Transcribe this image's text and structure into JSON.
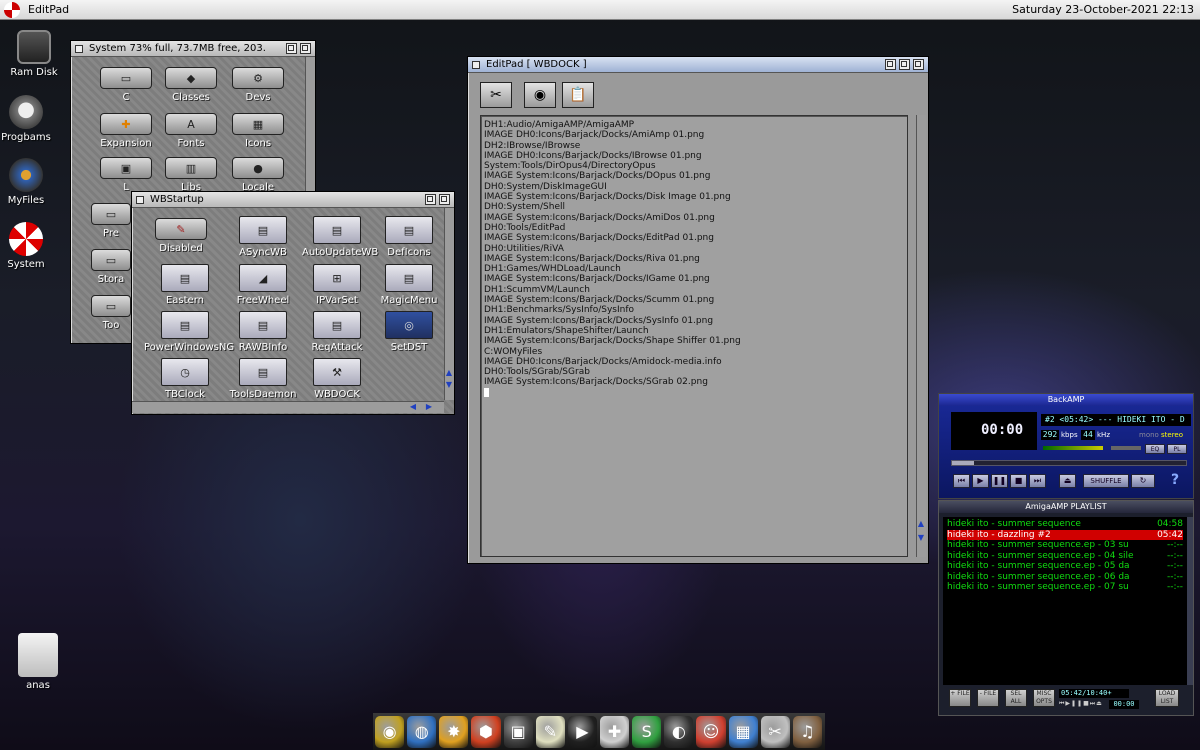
{
  "topbar": {
    "title": "EditPad",
    "clock": "Saturday 23-October-2021 22:13"
  },
  "desktop_icons": [
    {
      "label": "Ram Disk",
      "icon": "chip-icon"
    },
    {
      "label": "Progbams",
      "icon": "drive-icon"
    },
    {
      "label": "MyFiles",
      "icon": "disk-icon"
    },
    {
      "label": "System",
      "icon": "boing-ball-icon"
    },
    {
      "label": "anas",
      "icon": "harddisk-icon"
    }
  ],
  "system_window": {
    "title": "System  73% full, 73.7MB free, 203.",
    "icons": [
      "C",
      "Classes",
      "Devs",
      "Expansion",
      "Fonts",
      "Icons",
      "L",
      "Libs",
      "Locale",
      "Prefs",
      "Storage",
      "Tools"
    ],
    "partial_labels": [
      "L",
      "Libs",
      "Locale",
      "Pre",
      "Stora",
      "Too"
    ]
  },
  "wbstartup": {
    "title": "WBStartup",
    "icons": [
      "Disabled",
      "ASyncWB",
      "AutoUpdateWB",
      "DefIcons",
      "Eastern",
      "FreeWheel",
      "IPVarSet",
      "MagicMenu",
      "PowerWindowsNG",
      "RAWBInfo",
      "ReqAttack",
      "SetDST",
      "TBClock",
      "ToolsDaemon",
      "WBDOCK"
    ]
  },
  "editpad": {
    "title": "EditPad [ WBDOCK ]",
    "lines": [
      "DH1:Audio/AmigaAMP/AmigaAMP",
      "IMAGE DH0:Icons/Barjack/Docks/AmiAmp 01.png",
      "DH2:IBrowse/IBrowse",
      "IMAGE DH0:Icons/Barjack/Docks/IBrowse 01.png",
      "System:Tools/DirOpus4/DirectoryOpus",
      "IMAGE System:Icons/Barjack/Docks/DOpus 01.png",
      "DH0:System/DiskImageGUI",
      "IMAGE System:Icons/Barjack/Docks/Disk Image 01.png",
      "DH0:System/Shell",
      "IMAGE System:Icons/Barjack/Docks/AmiDos 01.png",
      "DH0:Tools/EditPad",
      "IMAGE System:Icons/Barjack/Docks/EditPad 01.png",
      "DH0:Utilities/RiVA",
      "IMAGE System:Icons/Barjack/Docks/Riva 01.png",
      "DH1:Games/WHDLoad/Launch",
      "IMAGE System:Icons/Barjack/Docks/IGame 01.png",
      "DH1:ScummVM/Launch",
      "IMAGE System:Icons/Barjack/Docks/Scumm 01.png",
      "DH1:Benchmarks/SysInfo/SysInfo",
      "IMAGE System:Icons/Barjack/Docks/SysInfo 01.png",
      "DH1:Emulators/ShapeShifter/Launch",
      "IMAGE System:Icons/Barjack/Docks/Shape Shiffer 01.png",
      "C:WOMyFiles",
      "IMAGE DH0:Icons/Barjack/Docks/Amidock-media.info",
      "DH0:Tools/SGrab/SGrab",
      "IMAGE System:Icons/Barjack/Docks/SGrab 02.png"
    ],
    "toolbar": [
      "scissors-icon",
      "camera-icon",
      "clipboard-icon"
    ]
  },
  "backamp": {
    "title": "BackAMP",
    "time": "00:00",
    "track_info": "#2 <05:42> --- HIDEKI ITO - D",
    "kbps": "292",
    "kbps_label": "kbps",
    "khz": "44",
    "khz_label": "kHz",
    "mono": "mono",
    "stereo": "stereo",
    "eq": "EQ",
    "pl": "PL",
    "shuffle": "SHUFFLE",
    "help": "?"
  },
  "playlist": {
    "title": "AmigaAMP PLAYLIST",
    "rows": [
      {
        "title": "hideki ito - summer sequence",
        "time": "04:58",
        "current": false
      },
      {
        "title": "hideki ito - dazzling #2",
        "time": "05:42",
        "current": true
      },
      {
        "title": "hideki ito - summer sequence.ep - 03 su",
        "time": "--:--",
        "current": false
      },
      {
        "title": "hideki ito - summer sequence.ep - 04 sile",
        "time": "--:--",
        "current": false
      },
      {
        "title": "hideki ito - summer sequence.ep - 05 da",
        "time": "--:--",
        "current": false
      },
      {
        "title": "hideki ito - summer sequence.ep - 06 da",
        "time": "--:--",
        "current": false
      },
      {
        "title": "hideki ito - summer sequence.ep - 07 su",
        "time": "--:--",
        "current": false
      }
    ],
    "buttons": [
      "+ FILE",
      "- FILE",
      "SEL ALL",
      "MISC OPTS"
    ],
    "position": "05:42/10:40+",
    "elapsed": "00:00",
    "load_list": "LOAD LIST"
  },
  "dock": {
    "items": [
      "amigaamp-icon",
      "ibrowse-icon",
      "dopus-icon",
      "diskimage-icon",
      "shell-icon",
      "editpad-icon",
      "riva-icon",
      "igame-icon",
      "scumm-icon",
      "sysinfo-icon",
      "shapeshifter-icon",
      "myfiles-icon",
      "sgrab-icon",
      "media-icon"
    ],
    "colors": [
      "#c0a020",
      "#3070c0",
      "#e0a020",
      "#d04020",
      "#404040",
      "#e0e0c0",
      "#202020",
      "#d0d0d0",
      "#30a040",
      "#303030",
      "#d04030",
      "#4080d0",
      "#c0c0c0",
      "#806040"
    ]
  }
}
